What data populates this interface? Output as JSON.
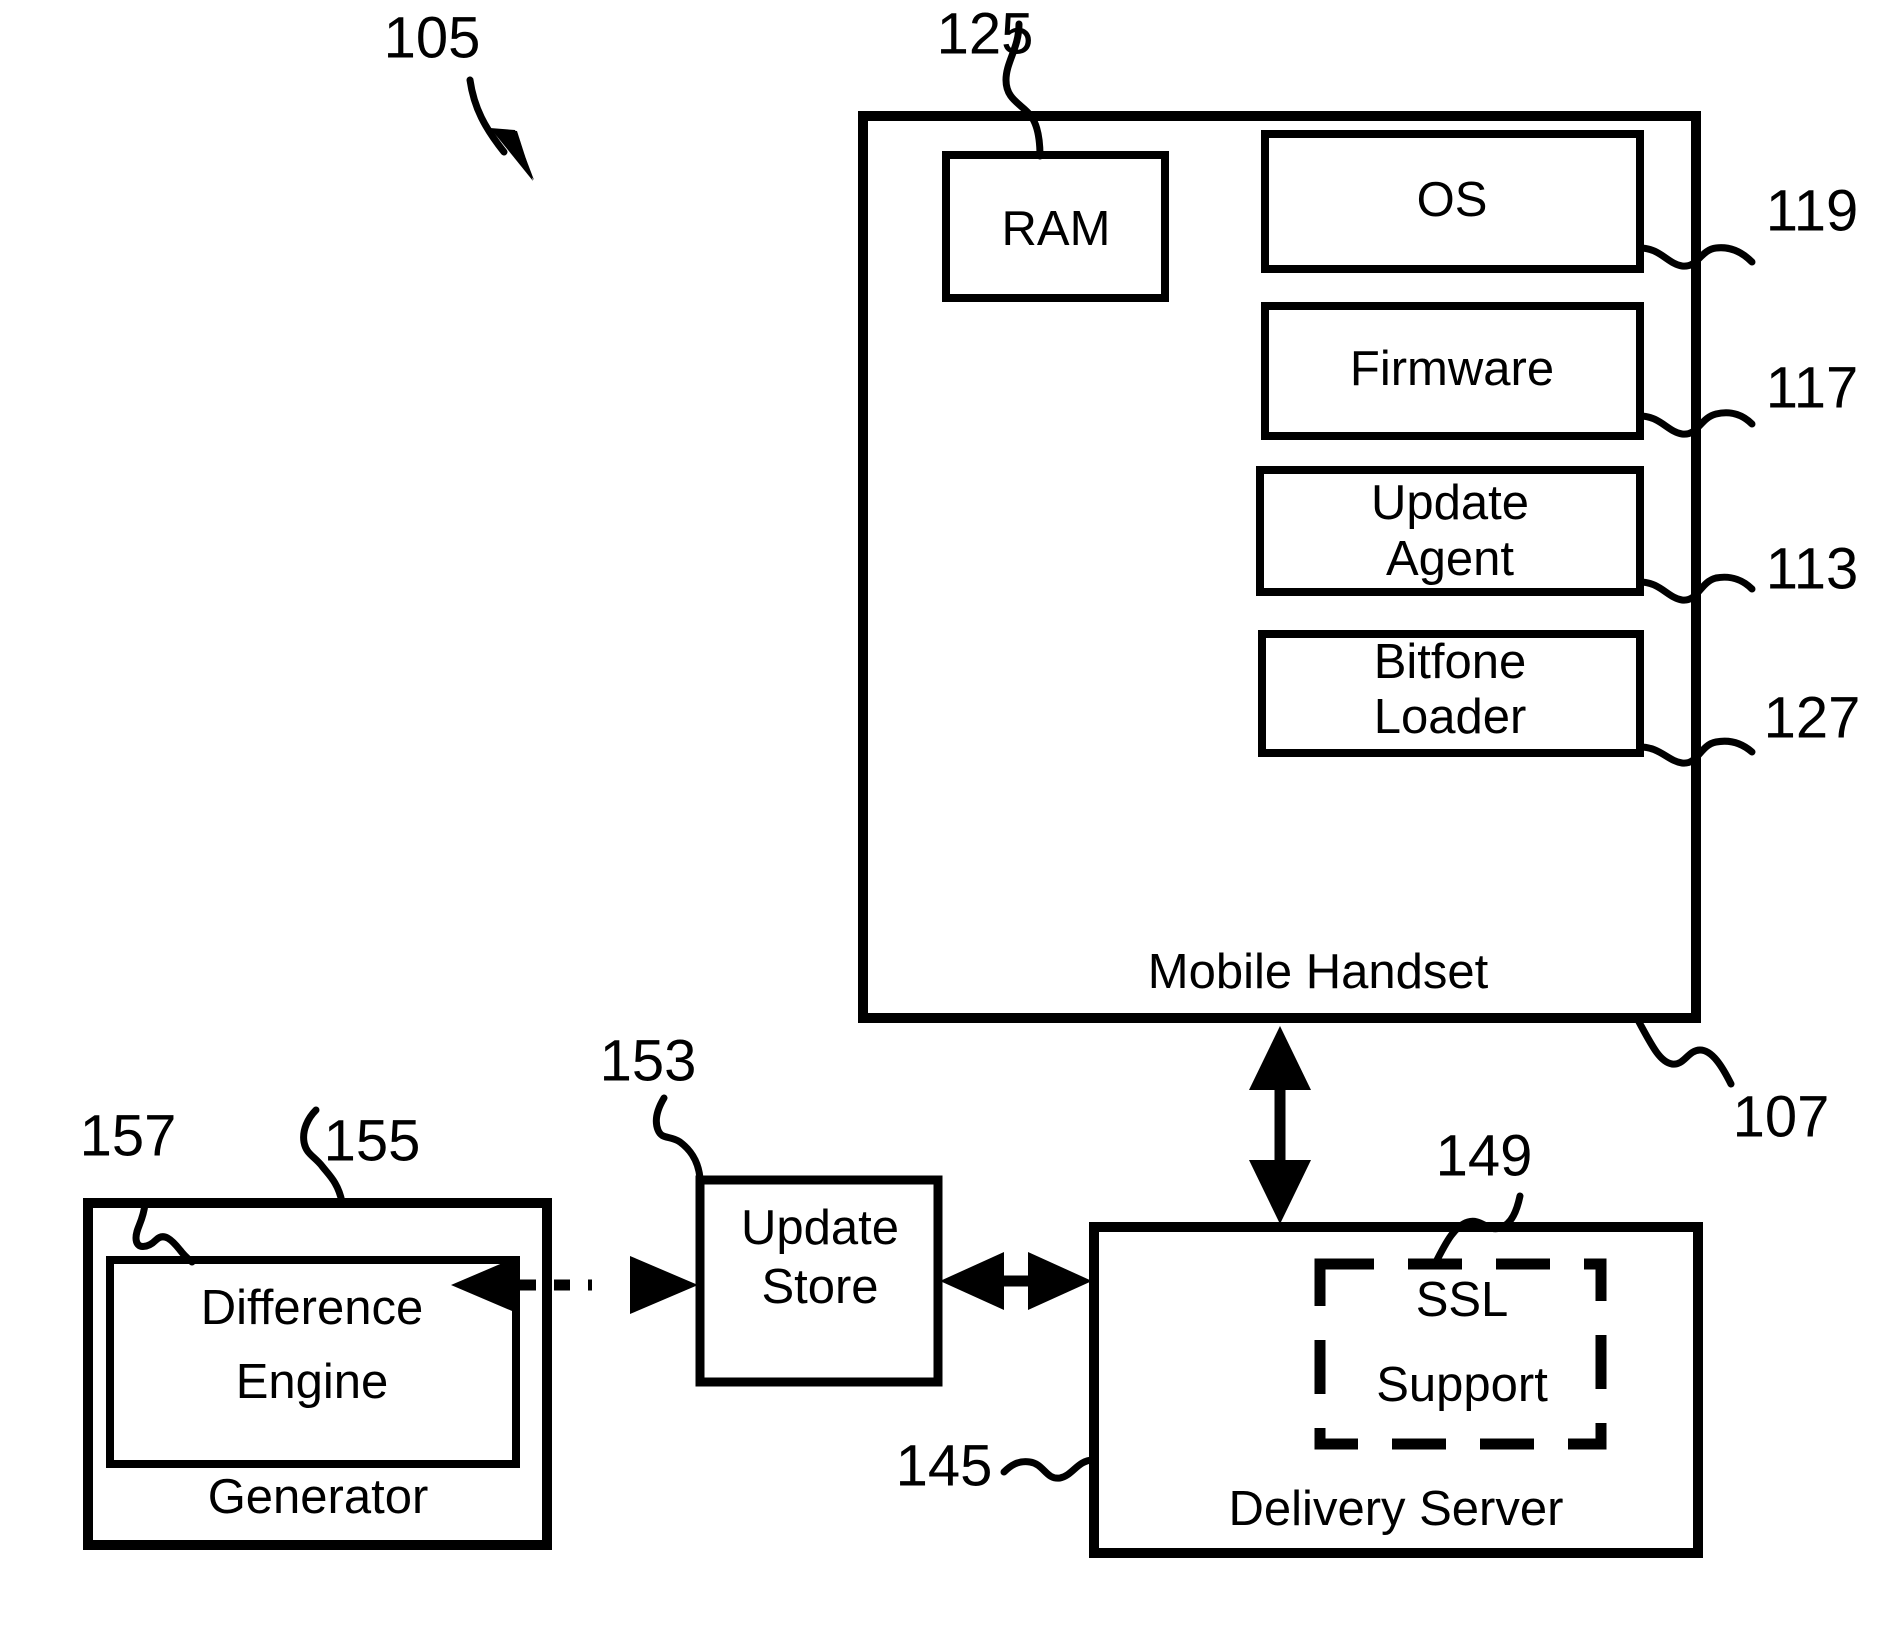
{
  "figure": {
    "title": "Mobile handset firmware update system block diagram",
    "ref_main": "105",
    "background_color": "#ffffff",
    "line_color": "#000000"
  },
  "mobile_handset": {
    "caption": "Mobile Handset",
    "ref": "107",
    "components": [
      {
        "id": "ram",
        "label": "RAM",
        "ref": "125",
        "ref_position": "top"
      },
      {
        "id": "os",
        "label": "OS",
        "ref": "119",
        "ref_position": "right"
      },
      {
        "id": "firmware",
        "label": "Firmware",
        "ref": "117",
        "ref_position": "right"
      },
      {
        "id": "update-agent",
        "label": "Update\nAgent",
        "ref": "113",
        "ref_position": "right"
      },
      {
        "id": "bitfone-loader",
        "label": "Bitfone\nLoader",
        "ref": "127",
        "ref_position": "right"
      }
    ],
    "component_labels": {
      "ram": "RAM",
      "os": "OS",
      "firmware": "Firmware",
      "update_agent_line1": "Update",
      "update_agent_line2": "Agent",
      "bitfone_loader_line1": "Bitfone",
      "bitfone_loader_line2": "Loader"
    },
    "refs": {
      "ram": "125",
      "os": "119",
      "firmware": "117",
      "update_agent": "113",
      "bitfone_loader": "127",
      "handset": "107"
    }
  },
  "delivery_server": {
    "caption": "Delivery Server",
    "ref": "145",
    "ssl": {
      "line1": "SSL",
      "line2": "Support",
      "ref": "149",
      "border_style": "dashed"
    }
  },
  "update_store": {
    "line1": "Update",
    "line2": "Store",
    "ref": "153"
  },
  "generator": {
    "caption": "Generator",
    "ref": "155",
    "difference_engine": {
      "line1": "Difference",
      "line2": "Engine",
      "ref": "157"
    }
  },
  "connections": [
    {
      "id": "handset-to-server",
      "from": "Mobile Handset",
      "to": "Delivery Server",
      "style": "solid",
      "arrows": "both",
      "orientation": "vertical"
    },
    {
      "id": "store-to-server",
      "from": "Update Store",
      "to": "Delivery Server",
      "style": "solid",
      "arrows": "both",
      "orientation": "horizontal"
    },
    {
      "id": "generator-to-store",
      "from": "Generator",
      "to": "Update Store",
      "style": "dashed",
      "arrows": "both",
      "orientation": "horizontal"
    }
  ]
}
